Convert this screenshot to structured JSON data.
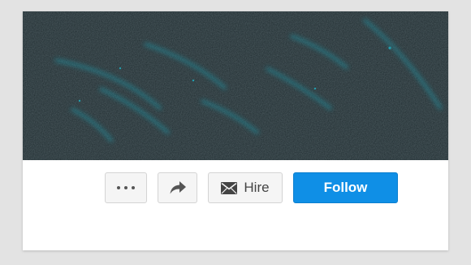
{
  "profile": {
    "actions": {
      "more_icon": "ellipsis-icon",
      "share_icon": "share-arrow-icon",
      "hire_icon": "envelope-icon",
      "hire_label": "Hire",
      "follow_label": "Follow"
    }
  },
  "colors": {
    "cover_bg": "#1e2a2e",
    "cover_accent": "#1aa3b5",
    "follow_bg": "#0f8fe6",
    "button_bg": "#f5f5f5"
  }
}
